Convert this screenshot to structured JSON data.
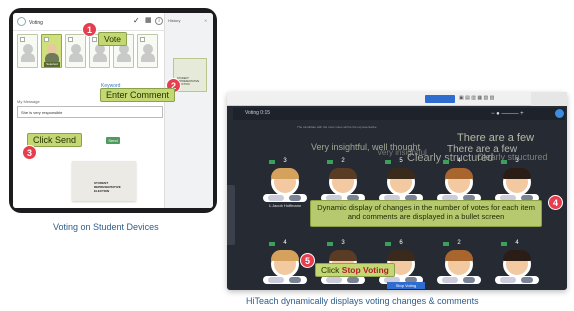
{
  "tablet": {
    "topbar": {
      "subtitle": "Voting",
      "check_icon": "check-icon",
      "grid_icon": "grid-icon",
      "info_icon": "info-icon"
    },
    "candidates": [
      {
        "selected": false
      },
      {
        "selected": true,
        "tag": "Selected"
      },
      {
        "selected": false
      },
      {
        "selected": false
      },
      {
        "selected": false
      },
      {
        "selected": false
      }
    ],
    "keyword": "Keyword",
    "comment_label": "My Message",
    "comment_value": "She is very responsible",
    "send_label": "Send",
    "history_title": "History",
    "ballot_text": "STUDENT REPRESENTATIVE ELECTION"
  },
  "desktop": {
    "title": "Voting  0:15",
    "sub": "The candidate with the most votes will be the representative",
    "bullets": [
      "There are a few",
      "There are a few",
      "Very insightful, well thought",
      "Very insightful",
      "Clearly structured",
      "Clearly structured"
    ],
    "candidates_top": [
      {
        "votes": "3",
        "name": "1.Jacob Hoffmann"
      },
      {
        "votes": "2",
        "name": ""
      },
      {
        "votes": "5",
        "name": ""
      },
      {
        "votes": "4",
        "name": ""
      },
      {
        "votes": "3",
        "name": ""
      }
    ],
    "candidates_bottom": [
      {
        "votes": "4",
        "name": ""
      },
      {
        "votes": "3",
        "name": ""
      },
      {
        "votes": "6",
        "name": ""
      },
      {
        "votes": "2",
        "name": ""
      },
      {
        "votes": "4",
        "name": ""
      }
    ],
    "stop_voting_label": "Stop Voting"
  },
  "callouts": {
    "c1": {
      "num": "1",
      "text": "Vote"
    },
    "c2": {
      "num": "2",
      "text": "Enter Comment"
    },
    "c3": {
      "num": "3",
      "text": "Click Send"
    },
    "c4": {
      "num": "4",
      "text": "Dynamic display of changes in the number of votes for each item and comments are displayed in a bullet screen"
    },
    "c5": {
      "num": "5",
      "text_prefix": "Click ",
      "text_emph": "Stop Voting"
    }
  },
  "captions": {
    "left": "Voting on Student Devices",
    "right": "HiTeach dynamically displays voting changes & comments"
  },
  "colors": {
    "callout": "#c3d773",
    "badge": "#e63d4f",
    "caption": "#2e5d8c",
    "app_bg": "#262a33"
  }
}
